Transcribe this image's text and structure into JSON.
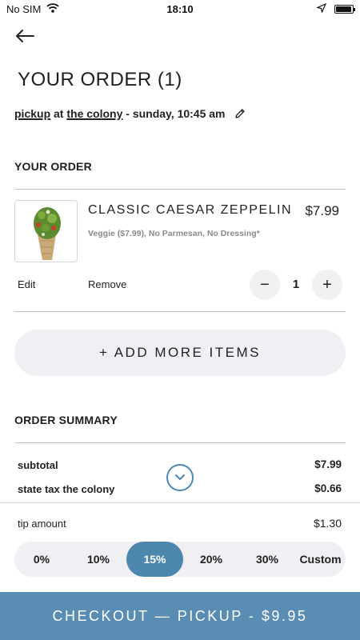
{
  "status_bar": {
    "carrier": "No SIM",
    "time": "18:10"
  },
  "header": {
    "title": "YOUR ORDER (1)"
  },
  "pickup": {
    "mode": "pickup",
    "at": " at ",
    "location": "the colony",
    "datetime": " - sunday, 10:45 am"
  },
  "order_section": {
    "heading": "YOUR ORDER",
    "items": [
      {
        "name": "CLASSIC CAESAR ZEPPELIN",
        "price": "$7.99",
        "modifiers": "Veggie ($7.99), No Parmesan, No Dressing*",
        "quantity": "1",
        "edit_label": "Edit",
        "remove_label": "Remove",
        "decrement_symbol": "−",
        "increment_symbol": "+"
      }
    ]
  },
  "add_more_label": "+ ADD MORE ITEMS",
  "summary": {
    "heading": "ORDER SUMMARY",
    "rows": [
      {
        "label": "subtotal",
        "value": "$7.99"
      },
      {
        "label": "state tax the colony",
        "value": "$0.66"
      }
    ]
  },
  "tip": {
    "label": "tip amount",
    "value": "$1.30",
    "options": [
      "0%",
      "10%",
      "15%",
      "20%",
      "30%",
      "Custom"
    ],
    "selected": "15%"
  },
  "checkout_label": "CHECKOUT — PICKUP - $9.95",
  "colors": {
    "accent": "#5a8db3",
    "tip_selected": "#4c88ae",
    "pill_bg": "#f0f0f4",
    "muted_text": "#8a8a8a"
  },
  "icons": {
    "back": "arrow-left-icon",
    "edit": "pencil-icon",
    "expand": "chevron-down-icon",
    "wifi": "wifi-icon",
    "location": "location-arrow-icon",
    "battery": "battery-icon"
  }
}
